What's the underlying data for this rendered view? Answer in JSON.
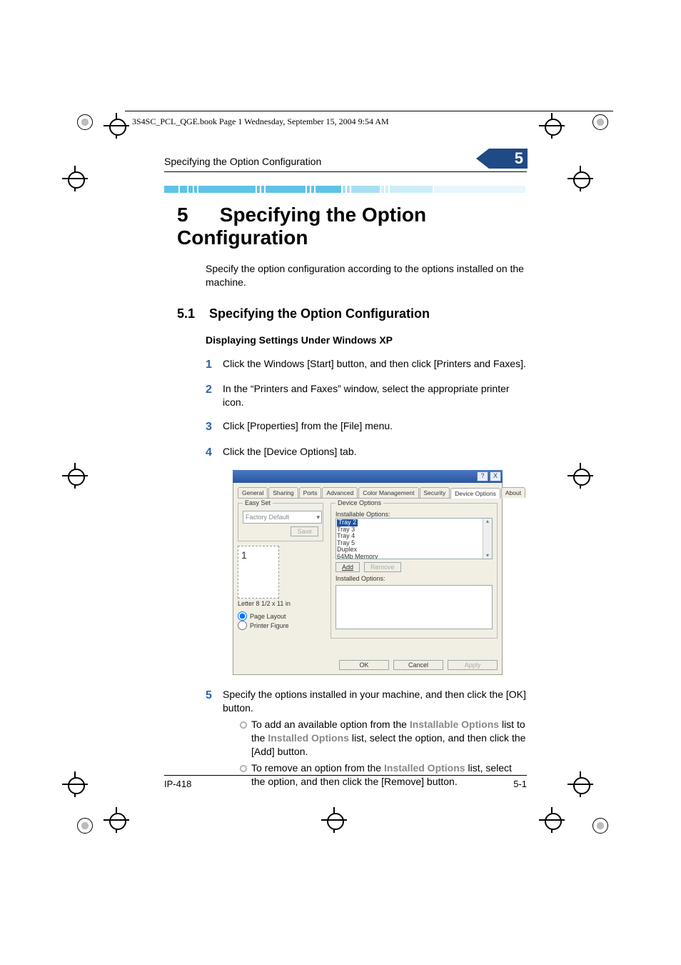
{
  "print_header": "3S4SC_PCL_QGE.book  Page 1  Wednesday, September 15, 2004  9:54 AM",
  "running_head": "Specifying the Option Configuration",
  "chapter_tab": "5",
  "chapter_num": "5",
  "chapter_title": "Specifying the Option Configuration",
  "intro": "Specify the option configuration according to the options installed on the machine.",
  "section_num": "5.1",
  "section_title": "Specifying the Option Configuration",
  "sub_title": "Displaying Settings Under Windows XP",
  "steps": [
    {
      "n": "1",
      "t": "Click the Windows [Start] button, and then click [Printers and Faxes]."
    },
    {
      "n": "2",
      "t": "In the “Printers and Faxes” window, select the appropriate printer icon."
    },
    {
      "n": "3",
      "t": "Click [Properties] from the [File] menu."
    },
    {
      "n": "4",
      "t": "Click the [Device Options] tab."
    }
  ],
  "step5": {
    "n": "5",
    "t": "Specify the options installed in your machine, and then click the [OK] button."
  },
  "bullets": [
    {
      "pre": "To add an available option from the ",
      "hl": "Installable Options",
      "mid": " list to the ",
      "hl2": "Installed Options",
      "post": " list, select the option, and then click the [Add] button."
    },
    {
      "pre": "To remove an option from the ",
      "hl": "Installed Options",
      "post": " list, select the option, and then click the [Remove] button."
    }
  ],
  "dialog": {
    "title_buttons": [
      "?",
      "X"
    ],
    "tabs": [
      "General",
      "Sharing",
      "Ports",
      "Advanced",
      "Color Management",
      "Security",
      "Device Options",
      "About"
    ],
    "active_tab": "Device Options",
    "easy_set_label": "Easy Set",
    "easy_set_value": "Factory Default",
    "save_btn": "Save",
    "paper_size": "Letter 8 1/2 x 11 in",
    "page_layout": "Page Layout",
    "printer_figure": "Printer Figure",
    "device_options_label": "Device Options",
    "installable_label": "Installable Options:",
    "installable": [
      "Tray 2",
      "Tray 3",
      "Tray 4",
      "Tray 5",
      "Duplex",
      "64Mb Memory"
    ],
    "installable_selected": "Tray 2",
    "add_btn": "Add",
    "remove_btn": "Remove",
    "installed_label": "Installed Options:",
    "ok": "OK",
    "cancel": "Cancel",
    "apply": "Apply"
  },
  "footer_left": "IP-418",
  "footer_right": "5-1"
}
